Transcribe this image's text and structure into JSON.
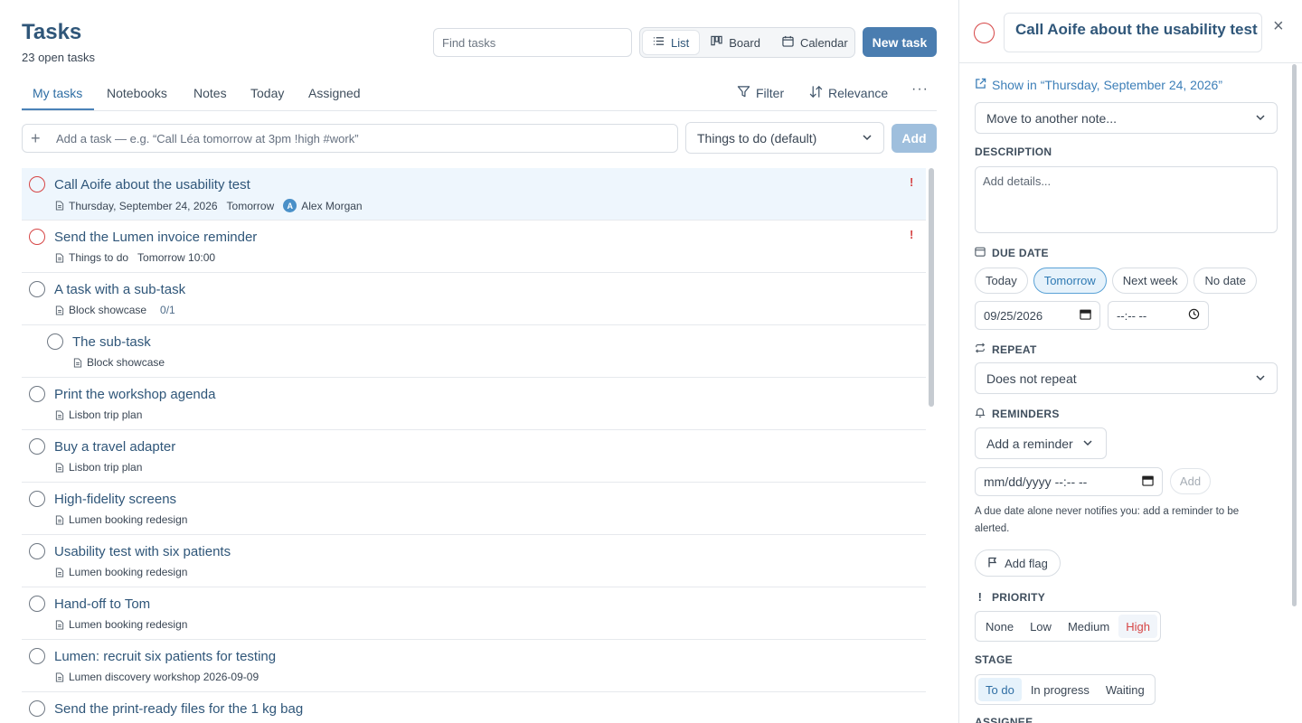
{
  "header": {
    "title": "Tasks",
    "subtitle": "23 open tasks",
    "search_placeholder": "Find tasks",
    "views": [
      {
        "label": "List",
        "icon": "list-icon",
        "active": true
      },
      {
        "label": "Board",
        "icon": "board-icon",
        "active": false
      },
      {
        "label": "Calendar",
        "icon": "calendar-icon",
        "active": false
      }
    ],
    "new_task_label": "New task"
  },
  "tabs": [
    {
      "label": "My tasks",
      "active": true
    },
    {
      "label": "Notebooks",
      "active": false
    },
    {
      "label": "Notes",
      "active": false
    },
    {
      "label": "Today",
      "active": false
    },
    {
      "label": "Assigned",
      "active": false
    }
  ],
  "toolbar": {
    "filter_label": "Filter",
    "sort_label": "Relevance",
    "more_label": "···"
  },
  "quick_add": {
    "placeholder": "Add a task — e.g. “Call Léa tomorrow at 3pm !high #work”",
    "list_value": "Things to do (default)",
    "add_label": "Add"
  },
  "tasks": [
    {
      "name": "Call Aoife about the usability test",
      "note": "Thursday, September 24, 2026",
      "due": "Tomorrow",
      "assignee_initial": "A",
      "assignee": "Alex Morgan",
      "priority_mark": "!",
      "selected": true,
      "red": true
    },
    {
      "name": "Send the Lumen invoice reminder",
      "note": "Things to do",
      "due": "Tomorrow 10:00",
      "priority_mark": "!",
      "red": true
    },
    {
      "name": "A task with a sub-task",
      "note": "Block showcase",
      "subtasks": "0/1"
    },
    {
      "name": "The sub-task",
      "note": "Block showcase",
      "child": true
    },
    {
      "name": "Print the workshop agenda",
      "note": "Lisbon trip plan"
    },
    {
      "name": "Buy a travel adapter",
      "note": "Lisbon trip plan"
    },
    {
      "name": "High-fidelity screens",
      "note": "Lumen booking redesign"
    },
    {
      "name": "Usability test with six patients",
      "note": "Lumen booking redesign"
    },
    {
      "name": "Hand-off to Tom",
      "note": "Lumen booking redesign"
    },
    {
      "name": "Lumen: recruit six patients for testing",
      "note": "Lumen discovery workshop 2026-09-09"
    },
    {
      "name": "Send the print-ready files for the 1 kg bag",
      "note": ""
    }
  ],
  "detail": {
    "title": "Call Aoife about the usability test",
    "show_in": "Show in “Thursday, September 24, 2026”",
    "move_to": "Move to another note...",
    "description_label": "DESCRIPTION",
    "description_placeholder": "Add details...",
    "due_label": "DUE DATE",
    "due_chips": [
      {
        "label": "Today",
        "on": false
      },
      {
        "label": "Tomorrow",
        "on": true
      },
      {
        "label": "Next week",
        "on": false
      },
      {
        "label": "No date",
        "on": false
      }
    ],
    "due_date_value": "09/25/2026",
    "due_time_value": "--:-- --",
    "repeat_label": "REPEAT",
    "repeat_value": "Does not repeat",
    "reminders_label": "REMINDERS",
    "add_reminder_label": "Add a reminder",
    "reminder_datetime_value": "mm/dd/yyyy --:-- --",
    "reminder_add_label": "Add",
    "reminder_hint": "A due date alone never notifies you: add a reminder to be alerted.",
    "flag_label": "Add flag",
    "priority_label": "PRIORITY",
    "priorities": [
      "None",
      "Low",
      "Medium",
      "High"
    ],
    "priority_selected": "High",
    "stage_label": "STAGE",
    "stages": [
      "To do",
      "In progress",
      "Waiting"
    ],
    "stage_selected": "To do",
    "assignee_label": "ASSIGNEE"
  },
  "colors": {
    "accent": "#4a7db0",
    "link": "#3d7fb8",
    "danger": "#d64545",
    "selected_row": "#eef6fd"
  }
}
